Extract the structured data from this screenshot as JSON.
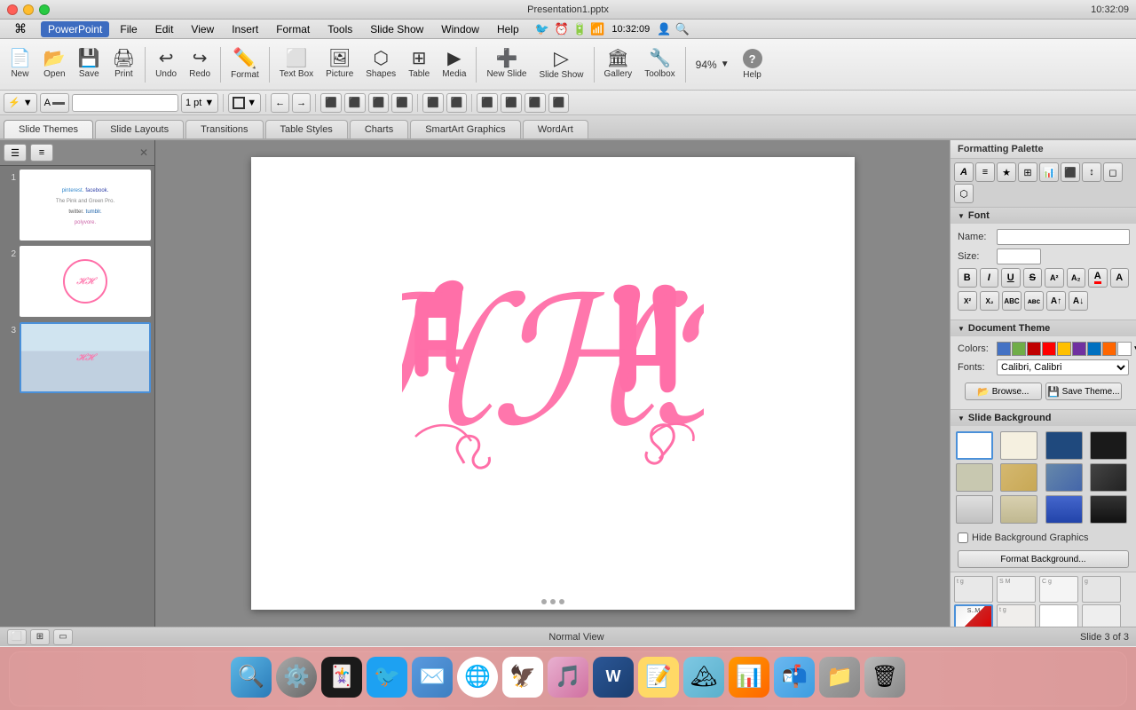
{
  "titlebar": {
    "title": "Presentation1.pptx",
    "close_label": "×",
    "min_label": "–",
    "max_label": "+",
    "system_info": "10:32:09"
  },
  "menubar": {
    "apple": "⌘",
    "items": [
      "PowerPoint",
      "File",
      "Edit",
      "View",
      "Insert",
      "Format",
      "Tools",
      "Slide Show",
      "Window",
      "Help"
    ]
  },
  "toolbar": {
    "buttons": [
      {
        "label": "New",
        "icon": "📄"
      },
      {
        "label": "Open",
        "icon": "📂"
      },
      {
        "label": "Save",
        "icon": "💾"
      },
      {
        "label": "Print",
        "icon": "🖨"
      },
      {
        "label": "Undo",
        "icon": "↩"
      },
      {
        "label": "Redo",
        "icon": "↪"
      },
      {
        "label": "Format",
        "icon": "🖊"
      },
      {
        "label": "Text Box",
        "icon": "⬜"
      },
      {
        "label": "Picture",
        "icon": "🖼"
      },
      {
        "label": "Shapes",
        "icon": "⬡"
      },
      {
        "label": "Table",
        "icon": "⊞"
      },
      {
        "label": "Media",
        "icon": "▶"
      },
      {
        "label": "New Slide",
        "icon": "➕"
      },
      {
        "label": "Slide Show",
        "icon": "▷"
      },
      {
        "label": "Gallery",
        "icon": "🏛"
      },
      {
        "label": "Toolbox",
        "icon": "🔧"
      },
      {
        "label": "Zoom",
        "icon": "🔍"
      },
      {
        "label": "Help",
        "icon": "?"
      }
    ],
    "zoom_value": "94%"
  },
  "tabs": {
    "items": [
      "Slide Themes",
      "Slide Layouts",
      "Transitions",
      "Table Styles",
      "Charts",
      "SmartArt Graphics",
      "WordArt"
    ],
    "active": "Slide Themes"
  },
  "slides": [
    {
      "num": "1",
      "selected": false
    },
    {
      "num": "2",
      "selected": false
    },
    {
      "num": "3",
      "selected": true
    }
  ],
  "formatting_palette": {
    "title": "Formatting Palette",
    "sections": {
      "font": {
        "title": "Font",
        "name_label": "Name:",
        "size_label": "Size:"
      },
      "document_theme": {
        "title": "Document Theme",
        "colors_label": "Colors:",
        "fonts_label": "Fonts:",
        "fonts_value": "Calibri, Calibri",
        "browse_label": "Browse...",
        "save_label": "Save Theme..."
      },
      "slide_background": {
        "title": "Slide Background",
        "hide_label": "Hide Background Graphics",
        "format_label": "Format Background..."
      }
    }
  },
  "status_bar": {
    "slide_info": "Slide 3 of 3",
    "view": "Normal View"
  },
  "colors": {
    "accent": "#4a90d9",
    "monogram": "#ff6fa8",
    "selected_slide_border": "#4a90d9"
  },
  "dock": {
    "items": [
      "Finder",
      "System Preferences",
      "Solitaire",
      "Twitter",
      "Mail Express",
      "Chrome",
      "Photos",
      "iTunes",
      "Word",
      "Stickies",
      "Preview",
      "Keynote",
      "Mail",
      "Finder2",
      "Trash"
    ]
  }
}
